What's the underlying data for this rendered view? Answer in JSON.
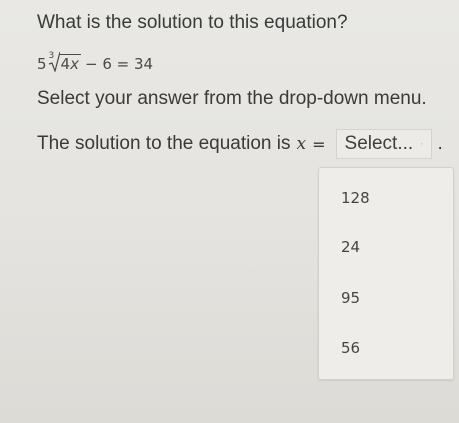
{
  "question": {
    "prompt": "What is the solution to this equation?"
  },
  "equation": {
    "coefficient": "5",
    "root_index": "3",
    "radicand_number": "4",
    "radicand_variable": "x",
    "rest": "− 6 = 34"
  },
  "instruction": "Select your answer from the drop-down menu.",
  "answer": {
    "prefix": "The solution to the equation is",
    "variable": "x",
    "equals": "=",
    "period": "."
  },
  "dropdown": {
    "selected_label": "Select...",
    "options": [
      "128",
      "24",
      "95",
      "56"
    ]
  },
  "icons": {
    "dropdown_indicator": "chevron-down-icon"
  },
  "colors": {
    "text": "#3a3a3a",
    "background": "#e6e5e1",
    "menu_background": "#eeede9"
  }
}
